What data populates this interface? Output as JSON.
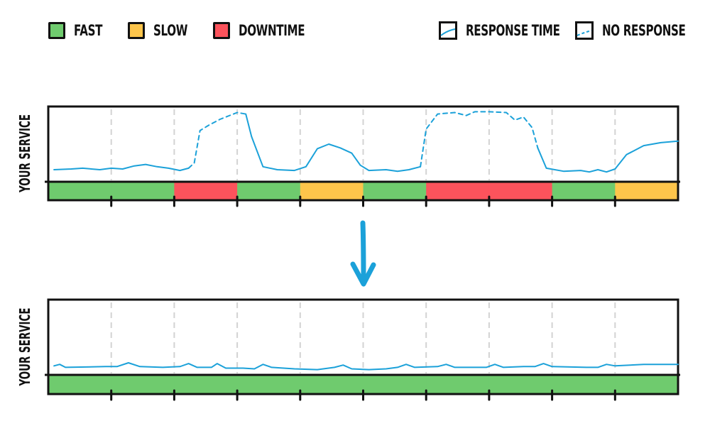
{
  "legend": {
    "status": [
      {
        "key": "fast",
        "label": "FAST",
        "color": "#6fcb6e"
      },
      {
        "key": "slow",
        "label": "SLOW",
        "color": "#fdc54b"
      },
      {
        "key": "downtime",
        "label": "DOWNTIME",
        "color": "#fc535c"
      }
    ],
    "lines": [
      {
        "key": "response",
        "label": "RESPONSE TIME",
        "style": "solid"
      },
      {
        "key": "noresponse",
        "label": "NO RESPONSE",
        "style": "dashed"
      }
    ]
  },
  "colors": {
    "line": "#1ba1d9",
    "grid": "#d3d3d3",
    "axis": "#111111",
    "arrow": "#1ba1d9"
  },
  "charts": [
    {
      "id": "before",
      "ylabel": "YOUR SERVICE",
      "segments": 10,
      "status": [
        "fast",
        "fast",
        "downtime",
        "fast",
        "slow",
        "fast",
        "downtime",
        "downtime",
        "fast",
        "slow"
      ],
      "response": [
        {
          "style": "solid",
          "points": [
            [
              0.1,
              0.16
            ],
            [
              0.4,
              0.17
            ],
            [
              0.6,
              0.18
            ],
            [
              0.9,
              0.16
            ],
            [
              1.1,
              0.18
            ],
            [
              1.3,
              0.17
            ],
            [
              1.5,
              0.21
            ],
            [
              1.7,
              0.23
            ],
            [
              1.9,
              0.2
            ],
            [
              2.1,
              0.18
            ],
            [
              2.3,
              0.15
            ],
            [
              2.45,
              0.18
            ]
          ]
        },
        {
          "style": "dashed",
          "points": [
            [
              2.45,
              0.18
            ],
            [
              2.55,
              0.25
            ],
            [
              2.65,
              0.68
            ],
            [
              2.8,
              0.75
            ],
            [
              3.0,
              0.83
            ],
            [
              3.3,
              0.92
            ],
            [
              3.45,
              0.9
            ]
          ]
        },
        {
          "style": "solid",
          "points": [
            [
              3.45,
              0.9
            ],
            [
              3.55,
              0.6
            ],
            [
              3.75,
              0.2
            ],
            [
              4.0,
              0.16
            ],
            [
              4.3,
              0.15
            ],
            [
              4.5,
              0.2
            ],
            [
              4.7,
              0.44
            ],
            [
              4.9,
              0.5
            ],
            [
              5.1,
              0.45
            ],
            [
              5.3,
              0.38
            ],
            [
              5.45,
              0.22
            ],
            [
              5.6,
              0.15
            ],
            [
              5.9,
              0.16
            ],
            [
              6.1,
              0.14
            ],
            [
              6.3,
              0.16
            ],
            [
              6.5,
              0.2
            ]
          ]
        },
        {
          "style": "dashed",
          "points": [
            [
              6.5,
              0.2
            ],
            [
              6.6,
              0.7
            ],
            [
              6.8,
              0.9
            ],
            [
              7.1,
              0.92
            ],
            [
              7.3,
              0.88
            ],
            [
              7.45,
              0.93
            ],
            [
              7.7,
              0.93
            ],
            [
              8.0,
              0.92
            ],
            [
              8.15,
              0.82
            ],
            [
              8.3,
              0.86
            ],
            [
              8.45,
              0.72
            ],
            [
              8.55,
              0.45
            ]
          ]
        },
        {
          "style": "solid",
          "points": [
            [
              8.55,
              0.45
            ],
            [
              8.7,
              0.18
            ],
            [
              9.0,
              0.14
            ],
            [
              9.3,
              0.15
            ],
            [
              9.45,
              0.13
            ],
            [
              9.6,
              0.16
            ],
            [
              9.75,
              0.13
            ],
            [
              9.9,
              0.17
            ],
            [
              10.1,
              0.36
            ],
            [
              10.4,
              0.48
            ],
            [
              10.7,
              0.52
            ],
            [
              11.0,
              0.54
            ]
          ]
        }
      ]
    },
    {
      "id": "after",
      "ylabel": "YOUR SERVICE",
      "segments": 10,
      "status": [
        "fast",
        "fast",
        "fast",
        "fast",
        "fast",
        "fast",
        "fast",
        "fast",
        "fast",
        "fast"
      ],
      "response": [
        {
          "style": "solid",
          "points": [
            [
              0.1,
              0.12
            ],
            [
              0.2,
              0.14
            ],
            [
              0.3,
              0.1
            ],
            [
              1.0,
              0.11
            ],
            [
              1.2,
              0.11
            ],
            [
              1.4,
              0.16
            ],
            [
              1.6,
              0.11
            ],
            [
              2.0,
              0.1
            ],
            [
              2.3,
              0.11
            ],
            [
              2.45,
              0.15
            ],
            [
              2.6,
              0.1
            ],
            [
              2.85,
              0.1
            ],
            [
              2.95,
              0.15
            ],
            [
              3.1,
              0.09
            ],
            [
              3.4,
              0.09
            ],
            [
              3.6,
              0.08
            ],
            [
              3.75,
              0.14
            ],
            [
              3.9,
              0.1
            ],
            [
              4.3,
              0.08
            ],
            [
              4.7,
              0.07
            ],
            [
              5.0,
              0.1
            ],
            [
              5.15,
              0.13
            ],
            [
              5.3,
              0.08
            ],
            [
              5.6,
              0.07
            ],
            [
              5.9,
              0.08
            ],
            [
              6.1,
              0.1
            ],
            [
              6.25,
              0.14
            ],
            [
              6.4,
              0.1
            ],
            [
              6.8,
              0.11
            ],
            [
              6.95,
              0.14
            ],
            [
              7.1,
              0.1
            ],
            [
              7.4,
              0.1
            ],
            [
              7.65,
              0.1
            ],
            [
              7.8,
              0.14
            ],
            [
              7.95,
              0.1
            ],
            [
              8.3,
              0.11
            ],
            [
              8.5,
              0.11
            ],
            [
              8.65,
              0.15
            ],
            [
              8.8,
              0.11
            ],
            [
              9.4,
              0.1
            ],
            [
              9.6,
              0.1
            ],
            [
              9.75,
              0.14
            ],
            [
              9.9,
              0.12
            ],
            [
              10.4,
              0.14
            ],
            [
              11.0,
              0.14
            ]
          ]
        }
      ]
    }
  ],
  "arrow": {
    "direction": "down"
  }
}
